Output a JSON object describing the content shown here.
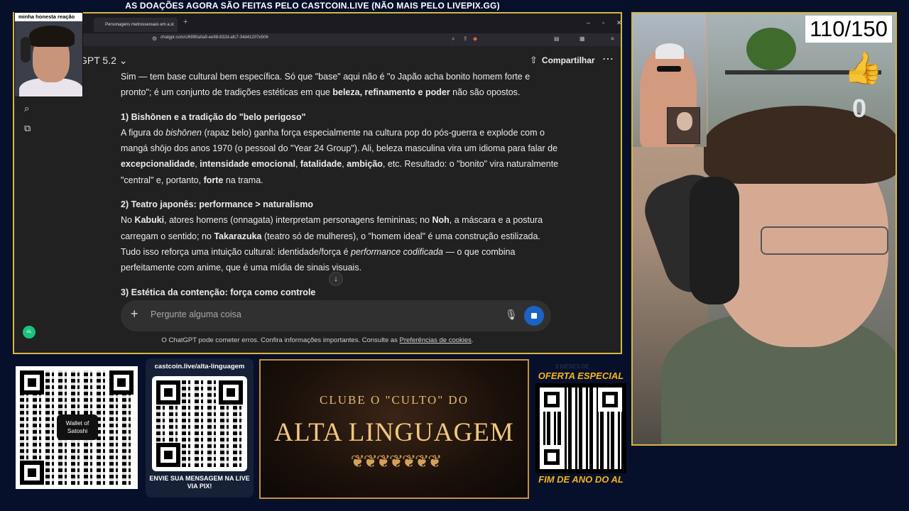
{
  "banner": "AS DOAÇÕES AGORA SÃO FEITAS PELO CASTCOIN.LIVE (NÃO MAIS PELO LIVEPIX.GG)",
  "browser": {
    "tab_title": "Personagens metrossexuais em a...",
    "url": "chatgpt.com/c/6990a0a9-ee98-832d-afc7-34d41207e506"
  },
  "chatgpt": {
    "model_label": "GPT 5.2 ⌄",
    "share_label": "Compartilhar",
    "intro": {
      "a": "Sim — tem base cultural bem específica. Só que \"base\" aqui não é \"o Japão acha bonito homem forte e pronto\"; é um conjunto de tradições estéticas em que ",
      "b": "beleza, refinamento e poder",
      "c": " não são opostos."
    },
    "s1": {
      "heading": "1) Bishōnen e a tradição do \"belo perigoso\"",
      "t1": "A figura do ",
      "i1": "bishōnen",
      "t2": " (rapaz belo) ganha força especialmente na cultura pop do pós-guerra e explode com o mangá shōjo dos anos 1970 (o pessoal do \"Year 24 Group\"). Ali, beleza masculina vira um idioma para falar de ",
      "b1": "excepcionalidade",
      "t3": ", ",
      "b2": "intensidade emocional",
      "t4": ", ",
      "b3": "fatalidade",
      "t5": ", ",
      "b4": "ambição",
      "t6": ", etc. Resultado: o \"bonito\" vira naturalmente \"central\" e, portanto, ",
      "b5": "forte",
      "t7": " na trama."
    },
    "s2": {
      "heading": "2) Teatro japonês: performance > naturalismo",
      "t1": "No ",
      "b1": "Kabuki",
      "t2": ", atores homens (onnagata) interpretam personagens femininas; no ",
      "b2": "Noh",
      "t3": ", a máscara e a postura carregam o sentido; no ",
      "b3": "Takarazuka",
      "t4": " (teatro só de mulheres), o \"homem ideal\" é uma construção estilizada. Tudo isso reforça uma intuição cultural: identidade/força é ",
      "i1": "performance codificada",
      "t5": " — o que combina perfeitamente com anime, que é uma mídia de sinais visuais."
    },
    "s3": {
      "heading": "3) Estética da contenção: força como controle"
    },
    "composer_placeholder": "Pergunte alguma coisa",
    "footer": {
      "text": "O ChatGPT pode cometer erros. Confira informações importantes. Consulte as ",
      "link": "Preferências de cookies",
      "end": "."
    },
    "user_initials": "AL"
  },
  "facecam_label": "minha honesta reação",
  "counter": "110/150",
  "likes": "0",
  "panels": {
    "wallet_label": "Wallet of Satoshi",
    "castcoin_url": "castcoin.live/alta-linguagem",
    "castcoin_bottom": "ENVIE SUA MENSAGEM NA LIVE VIA PIX!",
    "club_line1": "CLUBE O \"CULTO\" DO",
    "club_line2": "ALTA LINGUAGEM",
    "offer_top": "OFERTA ESPECIAL",
    "offer_ghost": "3 MESES DE",
    "offer_bottom": "FIM DE ANO DO AL"
  }
}
